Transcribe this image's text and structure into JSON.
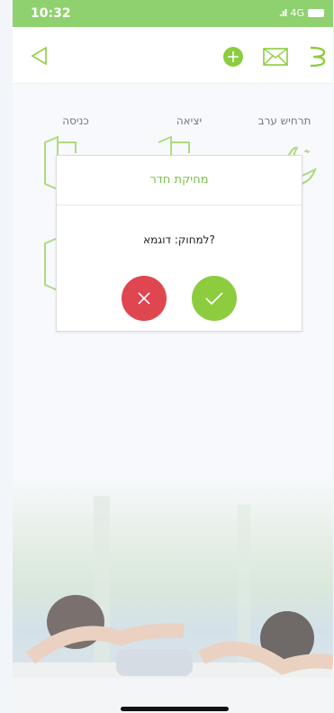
{
  "status_bar": {
    "time": "10:32",
    "network": "4G"
  },
  "rooms": [
    {
      "label": "תרחיש ערב"
    },
    {
      "label": "יציאה"
    },
    {
      "label": "כניסה"
    }
  ],
  "dialog": {
    "title": "מחיקת חדר",
    "message": "למחוק: דוגמא?"
  },
  "colors": {
    "accent_green": "#8ccc3e",
    "danger_red": "#e0464f",
    "status_bar": "#8fd16e"
  },
  "icons": [
    "back-icon",
    "add-icon",
    "mail-icon",
    "menu-icon",
    "door-icon",
    "moon-icon",
    "close-icon",
    "check-icon"
  ]
}
